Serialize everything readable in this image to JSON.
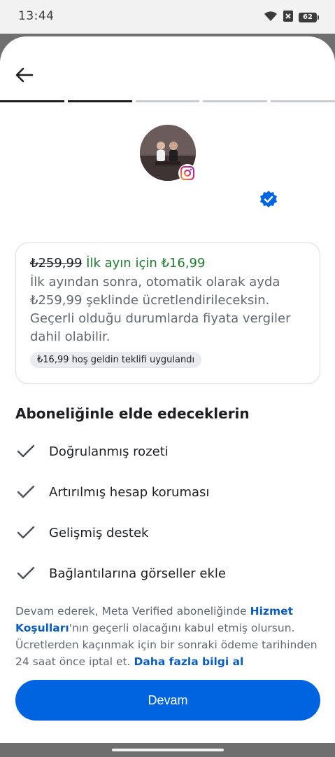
{
  "status_bar": {
    "time": "13:44",
    "battery_level": "62",
    "icons": [
      "wifi-icon",
      "no-sim-icon",
      "battery-icon"
    ]
  },
  "header": {
    "back_icon": "arrow-left-icon",
    "progress": {
      "total_steps": 5,
      "completed_steps": 2
    }
  },
  "profile": {
    "avatar": "profile-photo",
    "platform_badge": "instagram-icon",
    "verified_badge": "verified-badge-icon"
  },
  "offer": {
    "old_price": "₺259,99",
    "promo_text": "İlk ayın için ₺16,99",
    "description": "İlk ayından sonra, otomatik olarak ayda ₺259,99 şeklinde ücretlendirileceksin. Geçerli olduğu durumlarda fiyata vergiler dahil olabilir.",
    "chip": "₺16,99 hoş geldin teklifi uygulandı"
  },
  "benefits": {
    "title": "Aboneliğinle elde edeceklerin",
    "items": [
      {
        "label": "Doğrulanmış rozeti"
      },
      {
        "label": "Artırılmış hesap koruması"
      },
      {
        "label": "Gelişmiş destek"
      },
      {
        "label": "Bağlantılarına görseller ekle"
      }
    ]
  },
  "terms": {
    "part1": "Devam ederek, Meta Verified aboneliğinde ",
    "link1": "Hizmet Koşulları",
    "part2": "'nın geçerli olacağını kabul etmiş olursun. Ücretlerden kaçınmak için bir sonraki ödeme tarihinden 24 saat önce iptal et. ",
    "link2": "Daha fazla bilgi al"
  },
  "cta": {
    "label": "Devam"
  },
  "colors": {
    "primary": "#0064e0",
    "promo_green": "#1e7d2f",
    "link_blue": "#0a5ec0",
    "verified_blue": "#0064e0"
  }
}
